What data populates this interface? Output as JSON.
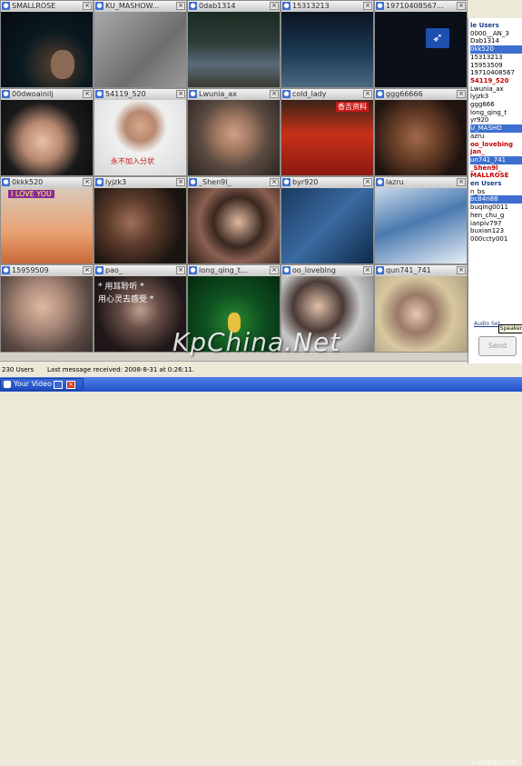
{
  "tiles": [
    {
      "name": "SMALLROSE"
    },
    {
      "name": "KU_MASHOW..."
    },
    {
      "name": "0dab1314"
    },
    {
      "name": "15313213"
    },
    {
      "name": "19710408567..."
    },
    {
      "name": "00dwoainilj"
    },
    {
      "name": "54119_520"
    },
    {
      "name": "Lwunia_ax"
    },
    {
      "name": "cold_lady"
    },
    {
      "name": "ggg66666"
    },
    {
      "name": "0kkk520"
    },
    {
      "name": "lyjzk3"
    },
    {
      "name": "_Shen9l_"
    },
    {
      "name": "byr920"
    },
    {
      "name": "lazru"
    },
    {
      "name": "15959509"
    },
    {
      "name": "pao_"
    },
    {
      "name": "long_qing_t..."
    },
    {
      "name": "oo_loveblng"
    },
    {
      "name": "qun741_741"
    }
  ],
  "overlays": {
    "cold_lady_caption": "香吉资料",
    "red_caption": "永不加入分状",
    "i_love_you": "I  LOVE  YOU",
    "poem_line1": "* 用耳聆听  *",
    "poem_line2": "用心灵去感受 *"
  },
  "right_panel": {
    "list": [
      "le Users",
      "0000__AN_3",
      "Dab1314",
      "0kk520",
      "15313213",
      "15953509",
      "19710408567",
      "54119_520",
      "Lwunia_ax",
      "lyjzk3",
      "ggg666",
      "long_qing_t",
      "yr920",
      "U_MASHO",
      "azru",
      "oo_lovebing",
      "jan_",
      "un741_741",
      "_Shen9l_",
      "MALLROSE",
      "en Users",
      "n_bs",
      "bc84n88",
      "buqing0011",
      "hen_chu_g",
      "ianpiv797",
      "buxian123",
      "000ccty001"
    ],
    "audio_settings": "Audio Set"
  },
  "tooltip": "Speaker",
  "send_label": "Send",
  "status": {
    "users": "230 Users",
    "last_message": "Last message received: 2008-8-31 at 0:26:11."
  },
  "taskbar": {
    "label": "Your Video"
  },
  "watermark": "KpChina.Net",
  "brand": "Lunqun.com"
}
